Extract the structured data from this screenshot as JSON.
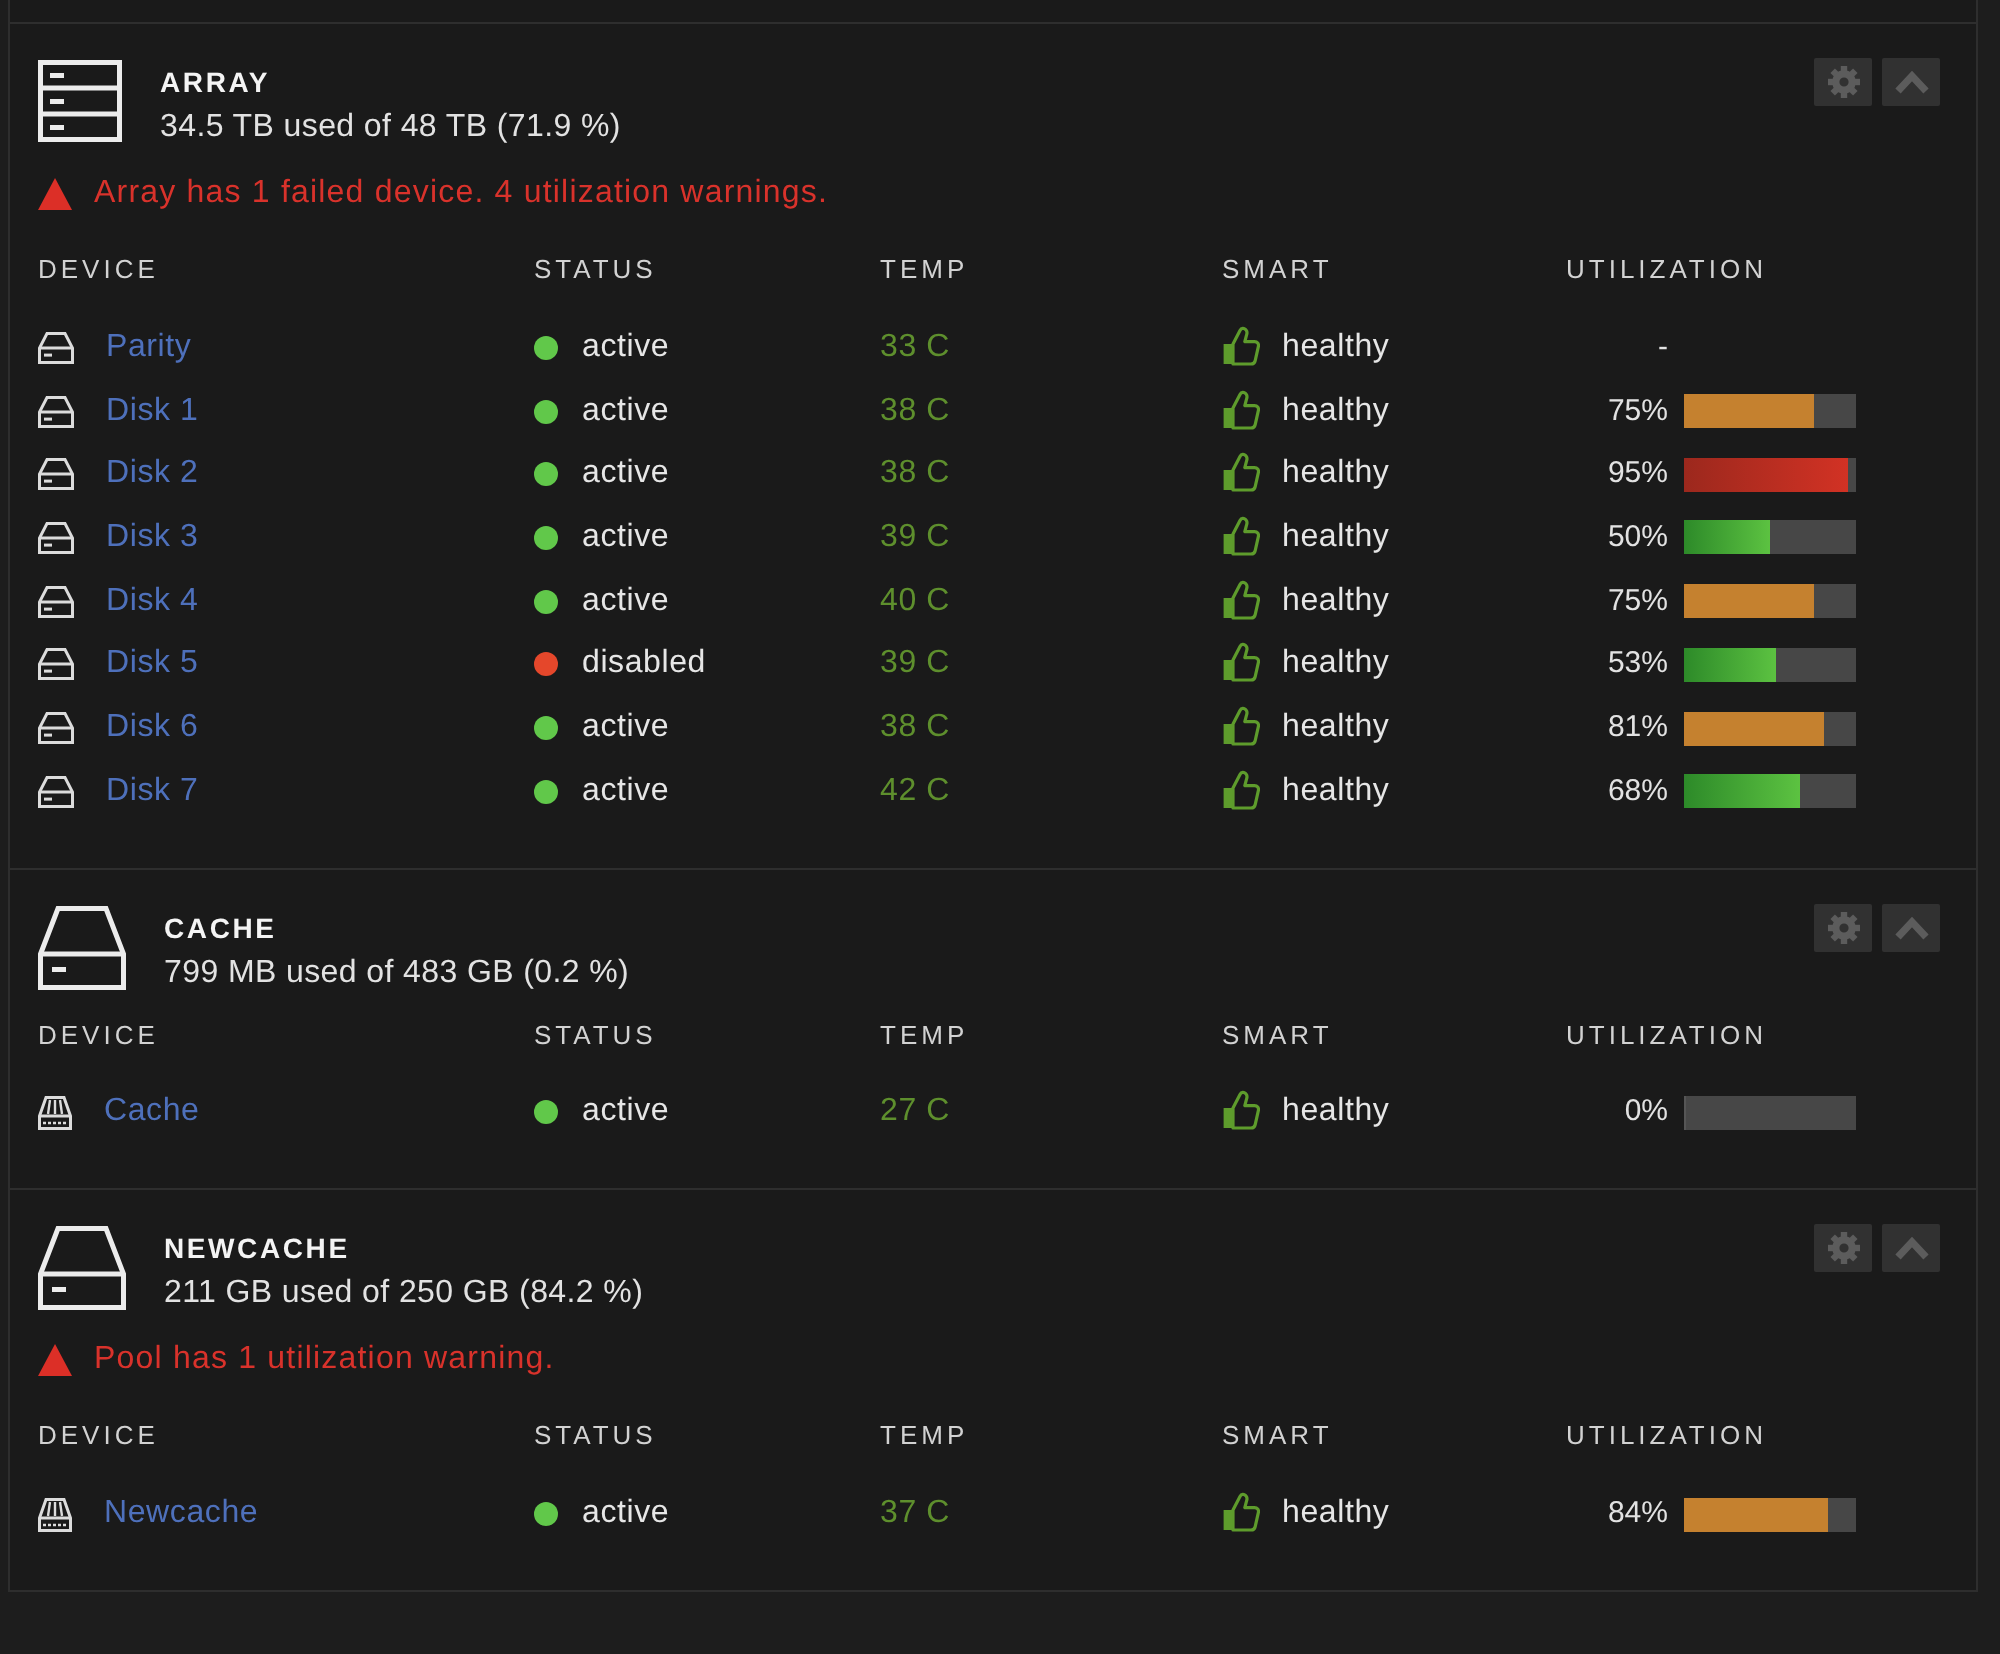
{
  "sections": [
    {
      "kind": "array",
      "title": "ARRAY",
      "usage": "34.5 TB used of 48 TB (71.9 %)",
      "expanded": true,
      "warning": "Array has 1 failed device. 4 utilization warnings.",
      "columns": [
        "DEVICE",
        "STATUS",
        "TEMP",
        "SMART",
        "UTILIZATION"
      ],
      "rows": [
        {
          "kind": "hdd",
          "name": "Parity",
          "status": {
            "text": "active",
            "color": "#61c84a"
          },
          "temp": "33 C",
          "smart": "healthy",
          "utilization": {
            "text": "-"
          }
        },
        {
          "kind": "hdd",
          "name": "Disk 1",
          "status": {
            "text": "active",
            "color": "#61c84a"
          },
          "temp": "38 C",
          "smart": "healthy",
          "utilization": {
            "text": "75%",
            "level": 0.75
          }
        },
        {
          "kind": "hdd",
          "name": "Disk 2",
          "status": {
            "text": "active",
            "color": "#61c84a"
          },
          "temp": "38 C",
          "smart": "healthy",
          "utilization": {
            "text": "95%",
            "level": 0.95
          }
        },
        {
          "kind": "hdd",
          "name": "Disk 3",
          "status": {
            "text": "active",
            "color": "#61c84a"
          },
          "temp": "39 C",
          "smart": "healthy",
          "utilization": {
            "text": "50%",
            "level": 0.5
          }
        },
        {
          "kind": "hdd",
          "name": "Disk 4",
          "status": {
            "text": "active",
            "color": "#61c84a"
          },
          "temp": "40 C",
          "smart": "healthy",
          "utilization": {
            "text": "75%",
            "level": 0.75
          }
        },
        {
          "kind": "hdd",
          "name": "Disk 5",
          "status": {
            "text": "disabled",
            "color": "#e5472b"
          },
          "temp": "39 C",
          "smart": "healthy",
          "utilization": {
            "text": "53%",
            "level": 0.53
          }
        },
        {
          "kind": "hdd",
          "name": "Disk 6",
          "status": {
            "text": "active",
            "color": "#61c84a"
          },
          "temp": "38 C",
          "smart": "healthy",
          "utilization": {
            "text": "81%",
            "level": 0.81
          }
        },
        {
          "kind": "hdd",
          "name": "Disk 7",
          "status": {
            "text": "active",
            "color": "#61c84a"
          },
          "temp": "42 C",
          "smart": "healthy",
          "utilization": {
            "text": "68%",
            "level": 0.68
          }
        }
      ]
    },
    {
      "kind": "pool",
      "title": "CACHE",
      "usage": "799 MB used of 483 GB (0.2 %)",
      "expanded": true,
      "columns": [
        "DEVICE",
        "STATUS",
        "TEMP",
        "SMART",
        "UTILIZATION"
      ],
      "rows": [
        {
          "kind": "ssd",
          "name": "Cache",
          "status": {
            "text": "active",
            "color": "#61c84a"
          },
          "temp": "27 C",
          "smart": "healthy",
          "utilization": {
            "text": "0%",
            "level": 0
          }
        }
      ]
    },
    {
      "kind": "pool",
      "title": "NEWCACHE",
      "usage": "211 GB used of 250 GB (84.2 %)",
      "expanded": true,
      "warning": "Pool has 1 utilization warning.",
      "columns": [
        "DEVICE",
        "STATUS",
        "TEMP",
        "SMART",
        "UTILIZATION"
      ],
      "rows": [
        {
          "kind": "ssd",
          "name": "Newcache",
          "status": {
            "text": "active",
            "color": "#61c84a"
          },
          "temp": "37 C",
          "smart": "healthy",
          "utilization": {
            "text": "84%",
            "level": 0.84
          }
        }
      ]
    }
  ]
}
